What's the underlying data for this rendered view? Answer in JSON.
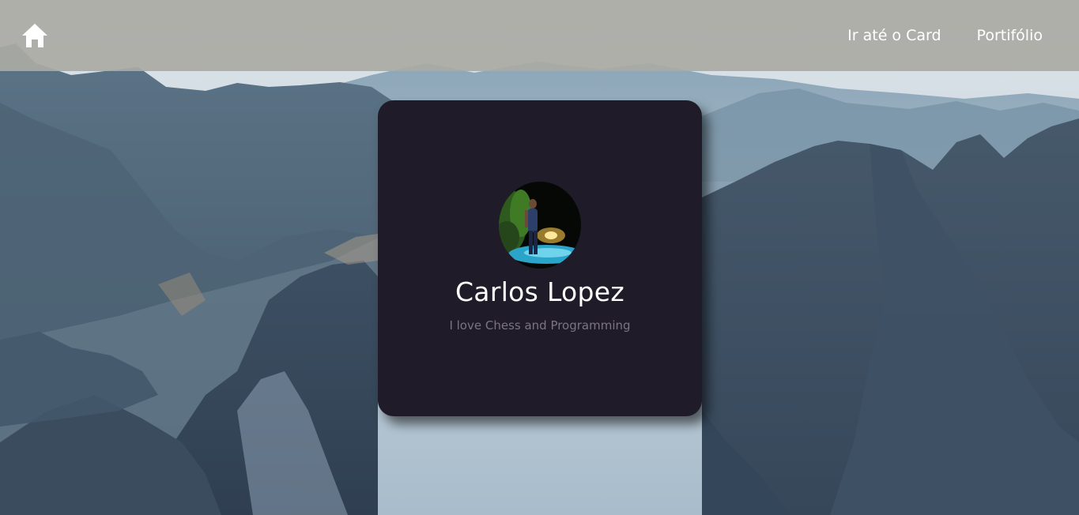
{
  "nav": {
    "home_icon": "home-icon",
    "links": [
      {
        "label": "Ir até o Card"
      },
      {
        "label": "Portifólio"
      }
    ]
  },
  "card": {
    "avatar_icon": "profile-photo",
    "name": "Carlos Lopez",
    "bio": "I love Chess and Programming"
  },
  "colors": {
    "navbar": "#aaaaa4",
    "card_bg": "#1f1b28",
    "name_text": "#ffffff",
    "bio_text": "#7a7484"
  }
}
